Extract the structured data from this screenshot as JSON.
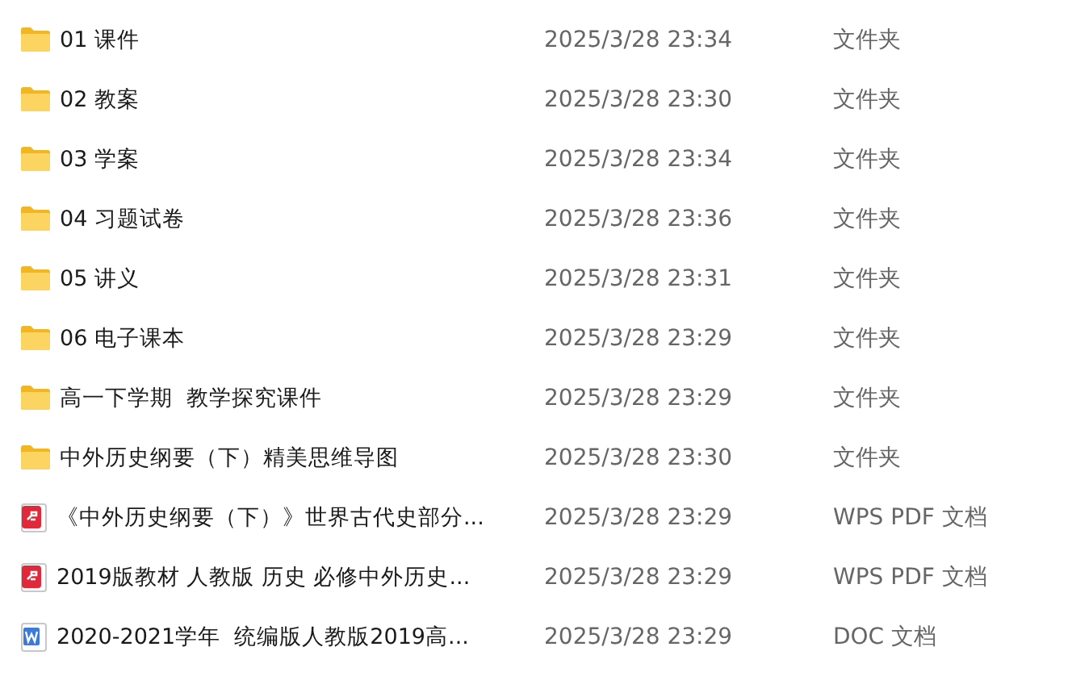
{
  "files": [
    {
      "kind": "folder",
      "name": "01 课件",
      "modified": "2025/3/28 23:34",
      "type": "文件夹"
    },
    {
      "kind": "folder",
      "name": "02 教案",
      "modified": "2025/3/28 23:30",
      "type": "文件夹"
    },
    {
      "kind": "folder",
      "name": "03 学案",
      "modified": "2025/3/28 23:34",
      "type": "文件夹"
    },
    {
      "kind": "folder",
      "name": "04 习题试卷",
      "modified": "2025/3/28 23:36",
      "type": "文件夹"
    },
    {
      "kind": "folder",
      "name": "05 讲义",
      "modified": "2025/3/28 23:31",
      "type": "文件夹"
    },
    {
      "kind": "folder",
      "name": "06 电子课本",
      "modified": "2025/3/28 23:29",
      "type": "文件夹"
    },
    {
      "kind": "folder",
      "name": "高一下学期  教学探究课件",
      "modified": "2025/3/28 23:29",
      "type": "文件夹"
    },
    {
      "kind": "folder",
      "name": "中外历史纲要（下）精美思维导图",
      "modified": "2025/3/28 23:30",
      "type": "文件夹"
    },
    {
      "kind": "pdf",
      "name": "《中外历史纲要（下）》世界古代史部分...",
      "modified": "2025/3/28 23:29",
      "type": "WPS PDF 文档"
    },
    {
      "kind": "pdf",
      "name": "2019版教材 人教版 历史 必修中外历史...",
      "modified": "2025/3/28 23:29",
      "type": "WPS PDF 文档"
    },
    {
      "kind": "doc",
      "name": "2020-2021学年  统编版人教版2019高...",
      "modified": "2025/3/28 23:29",
      "type": "DOC 文档"
    }
  ]
}
